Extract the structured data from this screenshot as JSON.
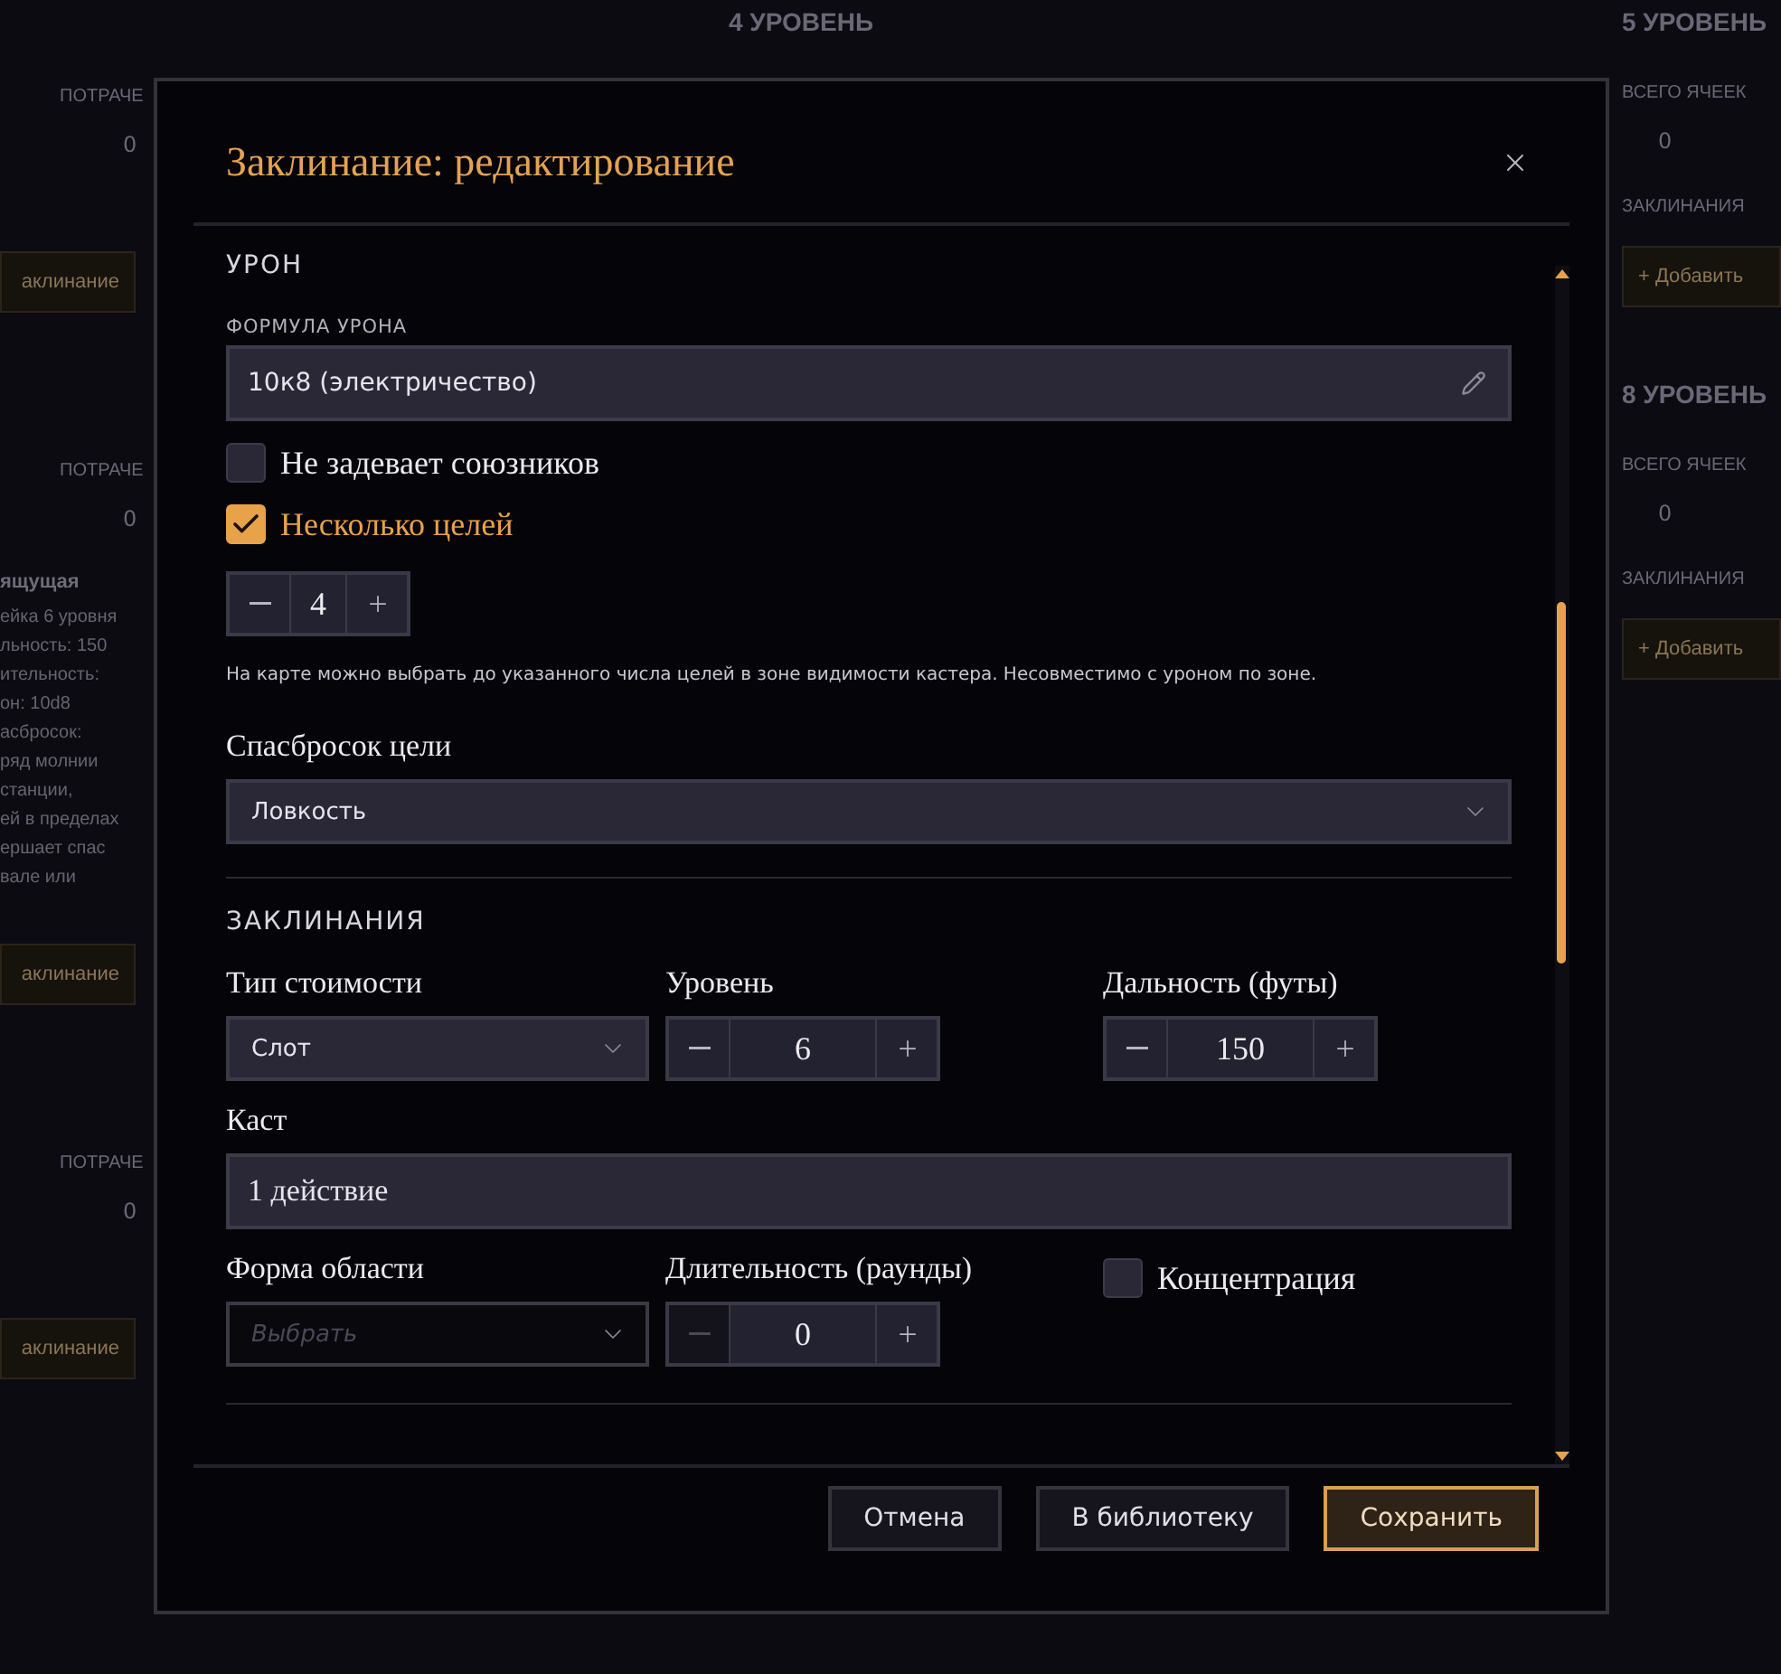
{
  "background": {
    "top_heading": "4 УРОВЕНЬ",
    "left_column": [
      {
        "kind": "label",
        "text": "ПОТРАЧЕ"
      },
      {
        "kind": "value",
        "text": "0"
      },
      {
        "kind": "button",
        "text": "аклинание"
      },
      {
        "kind": "label",
        "text": "ПОТРАЧЕ"
      },
      {
        "kind": "value",
        "text": "0"
      },
      {
        "kind": "title",
        "text": "ящущая"
      },
      {
        "kind": "text",
        "text": "ейка 6 уровня"
      },
      {
        "kind": "text",
        "text": "льность: 150"
      },
      {
        "kind": "text",
        "text": "ительность:"
      },
      {
        "kind": "text",
        "text": "он: 10d8"
      },
      {
        "kind": "text",
        "text": "асбросок:"
      },
      {
        "kind": "text",
        "text": "ряд молнии"
      },
      {
        "kind": "text",
        "text": "станции,"
      },
      {
        "kind": "text",
        "text": "ей в пределах"
      },
      {
        "kind": "text",
        "text": "ершает спас"
      },
      {
        "kind": "text",
        "text": "вале или"
      },
      {
        "kind": "button",
        "text": "аклинание"
      },
      {
        "kind": "label",
        "text": "ПОТРАЧЕ"
      },
      {
        "kind": "value",
        "text": "0"
      },
      {
        "kind": "button",
        "text": "аклинание"
      }
    ],
    "right_column": [
      {
        "kind": "heading",
        "text": "5 УРОВЕНЬ"
      },
      {
        "kind": "label",
        "text": "ВСЕГО ЯЧЕЕК"
      },
      {
        "kind": "value",
        "text": "0"
      },
      {
        "kind": "label",
        "text": "ЗАКЛИНАНИЯ"
      },
      {
        "kind": "button",
        "text": "+ Добавить"
      },
      {
        "kind": "heading",
        "text": "8 УРОВЕНЬ"
      },
      {
        "kind": "label",
        "text": "ВСЕГО ЯЧЕЕК"
      },
      {
        "kind": "value",
        "text": "0"
      },
      {
        "kind": "label",
        "text": "ЗАКЛИНАНИЯ"
      },
      {
        "kind": "button",
        "text": "+ Добавить"
      }
    ]
  },
  "dialog": {
    "title": "Заклинание: редактирование",
    "damage": {
      "heading": "УРОН",
      "formula_label": "ФОРМУЛА УРОНА",
      "formula_value": "10к8 (электричество)",
      "options": [
        {
          "label": "Не задевает союзников",
          "checked": false
        },
        {
          "label": "Несколько целей",
          "checked": true
        }
      ],
      "targets": {
        "value": "4",
        "minus_disabled": false
      },
      "hint": "На карте можно выбрать до указанного числа целей в зоне видимости кастера. Несовместимо с уроном по зоне.",
      "save_label": "Спасбросок цели",
      "save_value": "Ловкость"
    },
    "spells": {
      "heading": "ЗАКЛИНАНИЯ",
      "fields": [
        {
          "kind": "select",
          "label": "Тип стоимости",
          "value": "Слот"
        },
        {
          "kind": "stepper",
          "label": "Уровень",
          "value": "6",
          "minus_disabled": false
        },
        {
          "kind": "stepper",
          "label": "Дальность (футы)",
          "value": "150",
          "minus_disabled": false
        },
        {
          "kind": "text",
          "label": "Каст",
          "value": "1 действие"
        },
        {
          "kind": "select",
          "label": "Форма области",
          "placeholder": "Выбрать"
        },
        {
          "kind": "stepper",
          "label": "Длительность (раунды)",
          "value": "0",
          "minus_disabled": true
        },
        {
          "kind": "checkbox",
          "label": "Концентрация",
          "checked": false
        }
      ]
    },
    "buttons": [
      {
        "label": "Отмена",
        "primary": false
      },
      {
        "label": "В библиотеку",
        "primary": false
      },
      {
        "label": "Сохранить",
        "primary": true
      }
    ]
  }
}
